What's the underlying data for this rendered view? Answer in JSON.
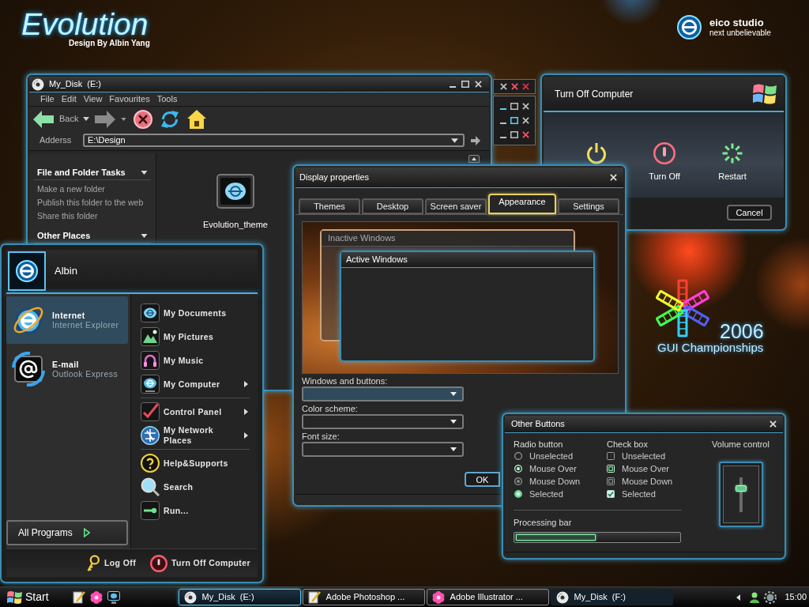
{
  "desktop": {
    "logo_title": "Evolution",
    "logo_credit": "Design By Albin Yang",
    "studio_name": "eico studio",
    "studio_tagline": "next unbelievable",
    "event_year": "2006",
    "event_name": "GUI Championships"
  },
  "explorer": {
    "title": "My_Disk  (E:)",
    "menu": [
      "File",
      "Edit",
      "View",
      "Favourites",
      "Tools"
    ],
    "back_label": "Back",
    "address_label": "Adderss",
    "address_value": "E:\\Design",
    "task_panels": [
      {
        "title": "File and Folder Tasks",
        "links": [
          "Make a new folder",
          "Publish this folder to the web",
          "Share this folder"
        ]
      },
      {
        "title": "Other Places"
      }
    ],
    "files": [
      {
        "name": "Evolution_theme"
      }
    ]
  },
  "caption_demo": {
    "close_buttons": [
      {
        "hover": false,
        "pressed": false
      },
      {
        "hover": true,
        "pressed": false
      },
      {
        "hover": false,
        "pressed": true
      }
    ],
    "rows": [
      {
        "buttons": [
          {
            "kind": "minimize",
            "hover": true
          },
          {
            "kind": "maximize",
            "hover": false
          },
          {
            "kind": "close",
            "hover": false
          }
        ]
      },
      {
        "buttons": [
          {
            "kind": "minimize",
            "hover": false
          },
          {
            "kind": "maximize",
            "hover": true
          },
          {
            "kind": "close",
            "hover": false
          }
        ]
      },
      {
        "buttons": [
          {
            "kind": "minimize",
            "hover": false
          },
          {
            "kind": "maximize",
            "hover": false
          },
          {
            "kind": "close",
            "hover": true
          }
        ]
      }
    ]
  },
  "turn_off_dialog": {
    "title": "Turn Off Computer",
    "options": [
      {
        "kind": "stand_by"
      },
      {
        "kind": "turn_off",
        "label": "Turn Off"
      },
      {
        "kind": "restart",
        "label": "Restart"
      }
    ],
    "cancel": "Cancel"
  },
  "display_properties": {
    "title": "Display properties",
    "tabs": [
      {
        "label": "Themes",
        "selected": false
      },
      {
        "label": "Desktop",
        "selected": false
      },
      {
        "label": "Screen saver",
        "selected": false
      },
      {
        "label": "Appearance",
        "selected": true
      },
      {
        "label": "Settings",
        "selected": false
      }
    ],
    "preview": {
      "inactive_title": "Inactive Windows",
      "active_title": "Active Windows"
    },
    "dropdowns": [
      {
        "label": "Windows and buttons:",
        "highlighted": true
      },
      {
        "label": "Color scheme:",
        "highlighted": false
      },
      {
        "label": "Font size:",
        "highlighted": false
      }
    ],
    "ok": "OK"
  },
  "other_buttons": {
    "title": "Other Buttons",
    "radio": {
      "heading": "Radio button",
      "items": [
        {
          "label": "Unselected",
          "checked": false,
          "hover": false,
          "pressed": false
        },
        {
          "label": "Mouse Over",
          "checked": false,
          "hover": true,
          "pressed": false
        },
        {
          "label": "Mouse Down",
          "checked": false,
          "hover": false,
          "pressed": true
        },
        {
          "label": "Selected",
          "checked": true,
          "hover": false,
          "pressed": false
        }
      ]
    },
    "checkbox": {
      "heading": "Check box",
      "items": [
        {
          "label": "Unselected",
          "checked": false,
          "hover": false,
          "pressed": false
        },
        {
          "label": "Mouse Over",
          "checked": false,
          "hover": true,
          "pressed": false
        },
        {
          "label": "Mouse Down",
          "checked": false,
          "hover": false,
          "pressed": true
        },
        {
          "label": "Selected",
          "checked": true,
          "hover": false,
          "pressed": false
        }
      ]
    },
    "progress": {
      "label": "Processing bar",
      "level": 0.49
    },
    "volume": {
      "label": "Volume control",
      "level": 0.72
    }
  },
  "start_menu": {
    "user": "Albin",
    "pinned": [
      {
        "kind": "browser",
        "title": "Internet",
        "subtitle": "Internet Explorer",
        "selected": true
      },
      {
        "kind": "email",
        "title": "E-mail",
        "subtitle": "Outlook Express",
        "selected": false
      }
    ],
    "all_programs": "All Programs",
    "place_groups": [
      {
        "items": [
          {
            "kind": "documents",
            "label": "My Documents",
            "submenu": false
          },
          {
            "kind": "pictures",
            "label": "My Pictures",
            "submenu": false
          },
          {
            "kind": "music",
            "label": "My Music",
            "submenu": false
          },
          {
            "kind": "computer",
            "label": "My Computer",
            "submenu": true
          }
        ]
      },
      {
        "items": [
          {
            "kind": "control_panel",
            "label": "Control Panel",
            "submenu": true
          },
          {
            "kind": "network",
            "label": "My Network Places",
            "submenu": true
          }
        ]
      },
      {
        "items": [
          {
            "kind": "help",
            "label": "Help&Supports",
            "submenu": false
          },
          {
            "kind": "search",
            "label": "Search",
            "submenu": false
          },
          {
            "kind": "run",
            "label": "Run...",
            "submenu": false
          }
        ]
      }
    ],
    "log_off": "Log Off",
    "turn_off": "Turn Off Computer"
  },
  "taskbar": {
    "start": "Start",
    "quick_launch": [
      {
        "kind": "pen"
      },
      {
        "kind": "flower"
      },
      {
        "kind": "monitor"
      }
    ],
    "tasks": [
      {
        "kind": "disc",
        "label": "My_Disk  (E:)",
        "selected": true,
        "raised": true
      },
      {
        "kind": "pen",
        "label": "Adobe Photoshop ...",
        "selected": false,
        "raised": true
      },
      {
        "kind": "flower",
        "label": "Adobe Illustrator ...",
        "selected": false,
        "raised": true
      },
      {
        "kind": "disc",
        "label": "My_Disk  (F:)",
        "selected": false,
        "raised": false
      }
    ],
    "clock": "15:00"
  }
}
